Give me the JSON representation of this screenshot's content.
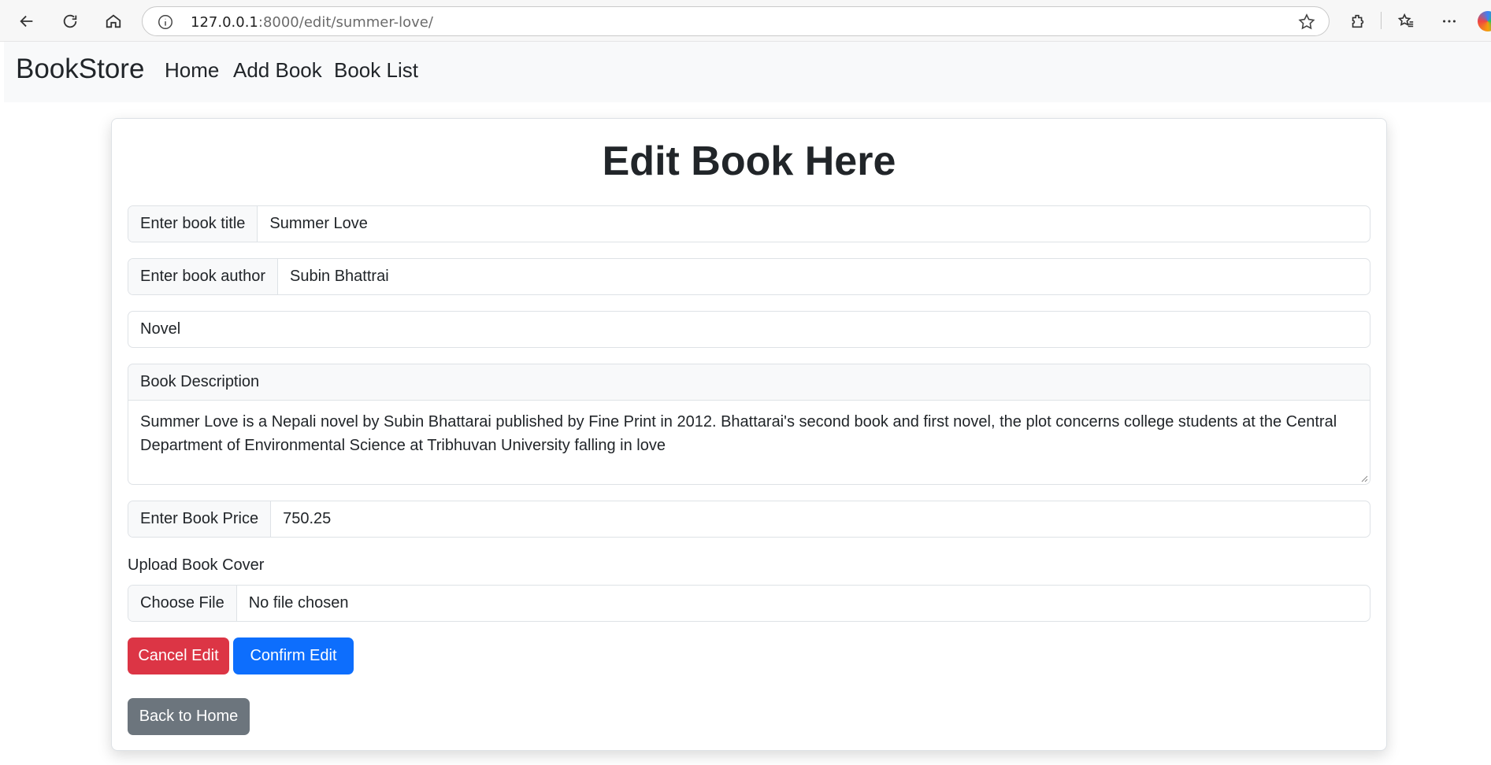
{
  "browser": {
    "url_host": "127.0.0.1",
    "url_path": ":8000/edit/summer-love/"
  },
  "navbar": {
    "brand": "BookStore",
    "links": [
      "Home",
      "Add Book",
      "Book List"
    ]
  },
  "form": {
    "heading": "Edit Book Here",
    "title_label": "Enter book title",
    "title_value": "Summer Love",
    "author_label": "Enter book author",
    "author_value": "Subin Bhattrai",
    "genre_value": "Novel",
    "description_label": "Book Description",
    "description_value": "Summer Love is a Nepali novel by Subin Bhattarai published by Fine Print in 2012. Bhattarai's second book and first novel, the plot concerns college students at the Central Department of Environmental Science at Tribhuvan University falling in love",
    "price_label": "Enter Book Price",
    "price_value": "750.25",
    "upload_label": "Upload Book Cover",
    "file_button": "Choose File",
    "file_status": "No file chosen",
    "cancel_button": "Cancel Edit",
    "confirm_button": "Confirm Edit",
    "back_button": "Back to Home"
  },
  "colors": {
    "cancel": "#dc3545",
    "confirm": "#0d6efd",
    "back": "#6c757d",
    "navbar_bg": "#f8f9fa"
  }
}
